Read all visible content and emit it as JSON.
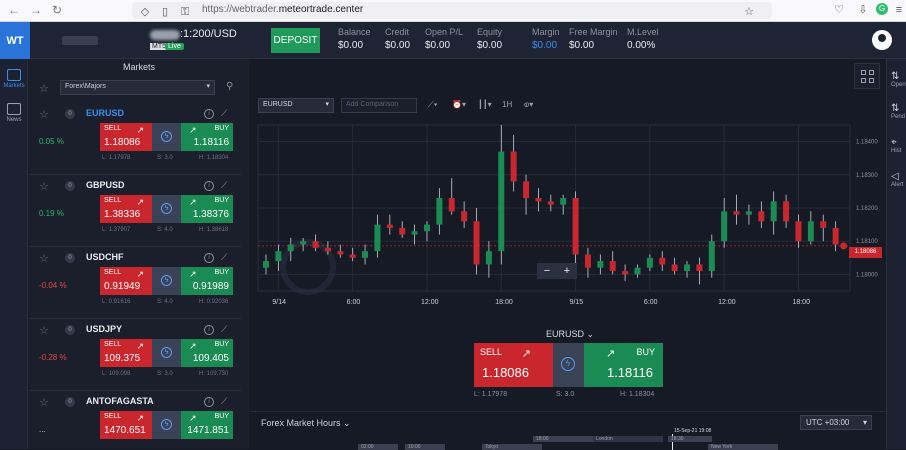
{
  "browser": {
    "url_scheme": "https://webtrader.",
    "url_domain": "meteortrade.center"
  },
  "topbar": {
    "logo": "WT",
    "account_number": ":1:200/USD",
    "platform_badge": "MT5",
    "live_badge": "Live",
    "deposit_label": "DEPOSIT",
    "stats": [
      {
        "label": "Balance",
        "value": "$0.00"
      },
      {
        "label": "Credit",
        "value": "$0.00"
      },
      {
        "label": "Open P/L",
        "value": "$0.00"
      },
      {
        "label": "Equity",
        "value": "$0.00"
      },
      {
        "label": "Margin",
        "value": "$0.00"
      },
      {
        "label": "Free Margin",
        "value": "$0.00"
      },
      {
        "label": "M.Level",
        "value": "0.00%"
      }
    ]
  },
  "rail": {
    "markets": "Markets",
    "news": "News"
  },
  "markets": {
    "title": "Markets",
    "group": "Forex\\Majors",
    "sell_label": "SELL",
    "buy_label": "BUY",
    "rows": [
      {
        "symbol": "EURUSD",
        "count": "0",
        "change": "0.05 %",
        "dir": "up",
        "sell": "1.18086",
        "buy": "1.18116",
        "low": "L: 1.17978",
        "spread": "S: 3.0",
        "high": "H: 1.18304"
      },
      {
        "symbol": "GBPUSD",
        "count": "0",
        "change": "0.19 %",
        "dir": "up",
        "sell": "1.38336",
        "buy": "1.38376",
        "low": "L: 1.37907",
        "spread": "S: 4.0",
        "high": "H: 1.38618"
      },
      {
        "symbol": "USDCHF",
        "count": "0",
        "change": "-0.04 %",
        "dir": "dn",
        "sell": "0.91949",
        "buy": "0.91989",
        "low": "L: 0.91616",
        "spread": "S: 4.0",
        "high": "H: 0.92036"
      },
      {
        "symbol": "USDJPY",
        "count": "0",
        "change": "-0.28 %",
        "dir": "dn",
        "sell": "109.375",
        "buy": "109.405",
        "low": "L: 109.098",
        "spread": "S: 3.0",
        "high": "H: 109.730"
      },
      {
        "symbol": "ANTOFAGASTA",
        "count": "0",
        "change": "...",
        "dir": "flat",
        "sell": "1470.651",
        "buy": "1471.851",
        "low": "",
        "spread": "",
        "high": ""
      }
    ]
  },
  "chart": {
    "symbol": "EURUSD",
    "comparison_placeholder": "Add Comparison",
    "timeframe": "1H",
    "last_price_tag": "1.18086"
  },
  "chart_data": {
    "type": "candlestick",
    "x_ticks": [
      "9/14",
      "6:00",
      "12:00",
      "18:00",
      "9/15",
      "6:00",
      "12:00",
      "18:00"
    ],
    "y_ticks": [
      "1.18400",
      "1.18300",
      "1.18200",
      "1.18100",
      "1.18000"
    ],
    "ylim": [
      1.1795,
      1.1845
    ],
    "last_price": 1.18086,
    "candles": [
      {
        "o": 1.1802,
        "h": 1.1806,
        "l": 1.18,
        "c": 1.1804
      },
      {
        "o": 1.1804,
        "h": 1.1809,
        "l": 1.1801,
        "c": 1.1807
      },
      {
        "o": 1.1807,
        "h": 1.1811,
        "l": 1.1804,
        "c": 1.1809
      },
      {
        "o": 1.1809,
        "h": 1.1811,
        "l": 1.1807,
        "c": 1.181
      },
      {
        "o": 1.181,
        "h": 1.1812,
        "l": 1.1807,
        "c": 1.1808
      },
      {
        "o": 1.1808,
        "h": 1.181,
        "l": 1.1806,
        "c": 1.1807
      },
      {
        "o": 1.1807,
        "h": 1.1809,
        "l": 1.1805,
        "c": 1.1806
      },
      {
        "o": 1.1806,
        "h": 1.1808,
        "l": 1.1804,
        "c": 1.1805
      },
      {
        "o": 1.1805,
        "h": 1.1809,
        "l": 1.1803,
        "c": 1.1807
      },
      {
        "o": 1.1807,
        "h": 1.1818,
        "l": 1.1805,
        "c": 1.1815
      },
      {
        "o": 1.1815,
        "h": 1.1818,
        "l": 1.1812,
        "c": 1.1814
      },
      {
        "o": 1.1814,
        "h": 1.1816,
        "l": 1.1811,
        "c": 1.1812
      },
      {
        "o": 1.1812,
        "h": 1.1815,
        "l": 1.1809,
        "c": 1.1813
      },
      {
        "o": 1.1813,
        "h": 1.1816,
        "l": 1.181,
        "c": 1.1815
      },
      {
        "o": 1.1815,
        "h": 1.1826,
        "l": 1.1812,
        "c": 1.1823
      },
      {
        "o": 1.1823,
        "h": 1.1829,
        "l": 1.1818,
        "c": 1.1819
      },
      {
        "o": 1.1819,
        "h": 1.1822,
        "l": 1.1814,
        "c": 1.1816
      },
      {
        "o": 1.1816,
        "h": 1.182,
        "l": 1.18,
        "c": 1.1803
      },
      {
        "o": 1.1803,
        "h": 1.181,
        "l": 1.1799,
        "c": 1.1807
      },
      {
        "o": 1.1807,
        "h": 1.1845,
        "l": 1.1803,
        "c": 1.1837
      },
      {
        "o": 1.1837,
        "h": 1.1842,
        "l": 1.1825,
        "c": 1.1828
      },
      {
        "o": 1.1828,
        "h": 1.183,
        "l": 1.1818,
        "c": 1.1823
      },
      {
        "o": 1.1823,
        "h": 1.1826,
        "l": 1.1819,
        "c": 1.1822
      },
      {
        "o": 1.1822,
        "h": 1.1824,
        "l": 1.1819,
        "c": 1.1821
      },
      {
        "o": 1.1821,
        "h": 1.1824,
        "l": 1.1818,
        "c": 1.1823
      },
      {
        "o": 1.1823,
        "h": 1.1825,
        "l": 1.1803,
        "c": 1.1806
      },
      {
        "o": 1.1806,
        "h": 1.1808,
        "l": 1.1799,
        "c": 1.1802
      },
      {
        "o": 1.1802,
        "h": 1.1806,
        "l": 1.18,
        "c": 1.1804
      },
      {
        "o": 1.1804,
        "h": 1.1807,
        "l": 1.18,
        "c": 1.1801
      },
      {
        "o": 1.1801,
        "h": 1.1803,
        "l": 1.1798,
        "c": 1.18
      },
      {
        "o": 1.18,
        "h": 1.1803,
        "l": 1.1799,
        "c": 1.1802
      },
      {
        "o": 1.1802,
        "h": 1.1806,
        "l": 1.1801,
        "c": 1.1805
      },
      {
        "o": 1.1805,
        "h": 1.1807,
        "l": 1.1801,
        "c": 1.1803
      },
      {
        "o": 1.1803,
        "h": 1.1805,
        "l": 1.18,
        "c": 1.1801
      },
      {
        "o": 1.1801,
        "h": 1.1804,
        "l": 1.1799,
        "c": 1.1803
      },
      {
        "o": 1.1803,
        "h": 1.1805,
        "l": 1.1797,
        "c": 1.1801
      },
      {
        "o": 1.1801,
        "h": 1.1812,
        "l": 1.1799,
        "c": 1.181
      },
      {
        "o": 1.181,
        "h": 1.1823,
        "l": 1.1808,
        "c": 1.1819
      },
      {
        "o": 1.1819,
        "h": 1.1824,
        "l": 1.1815,
        "c": 1.1818
      },
      {
        "o": 1.1818,
        "h": 1.1821,
        "l": 1.1815,
        "c": 1.1819
      },
      {
        "o": 1.1819,
        "h": 1.1822,
        "l": 1.1814,
        "c": 1.1816
      },
      {
        "o": 1.1816,
        "h": 1.1825,
        "l": 1.1812,
        "c": 1.1822
      },
      {
        "o": 1.1822,
        "h": 1.1824,
        "l": 1.1814,
        "c": 1.1816
      },
      {
        "o": 1.1816,
        "h": 1.1818,
        "l": 1.1808,
        "c": 1.181
      },
      {
        "o": 1.181,
        "h": 1.1819,
        "l": 1.1809,
        "c": 1.1816
      },
      {
        "o": 1.1816,
        "h": 1.1818,
        "l": 1.181,
        "c": 1.1814
      },
      {
        "o": 1.1814,
        "h": 1.1816,
        "l": 1.1807,
        "c": 1.1809
      }
    ]
  },
  "trade": {
    "symbol": "EURUSD",
    "sell_label": "SELL",
    "buy_label": "BUY",
    "sell_price": "1.18086",
    "buy_price": "1.18116",
    "low": "L: 1.17978",
    "spread": "S: 3.0",
    "high": "H: 1.18304"
  },
  "forex_hours": {
    "title": "Forex Market Hours",
    "timezone": "UTC +03:00",
    "now": "15-Sep-21 19:08",
    "sessions": [
      {
        "name": "Tokyo",
        "start": "02:00"
      },
      {
        "name": "London",
        "start": "10:00"
      },
      {
        "name": "New York",
        "start": "15:00"
      }
    ],
    "time_labels": [
      "18:00",
      "18:30"
    ]
  },
  "right_rail": [
    "Open",
    "Pend",
    "Hist",
    "Alert"
  ],
  "colors": {
    "sell": "#c9262d",
    "buy": "#1b8b54",
    "accent": "#2a73d9",
    "bg": "#161a25"
  }
}
